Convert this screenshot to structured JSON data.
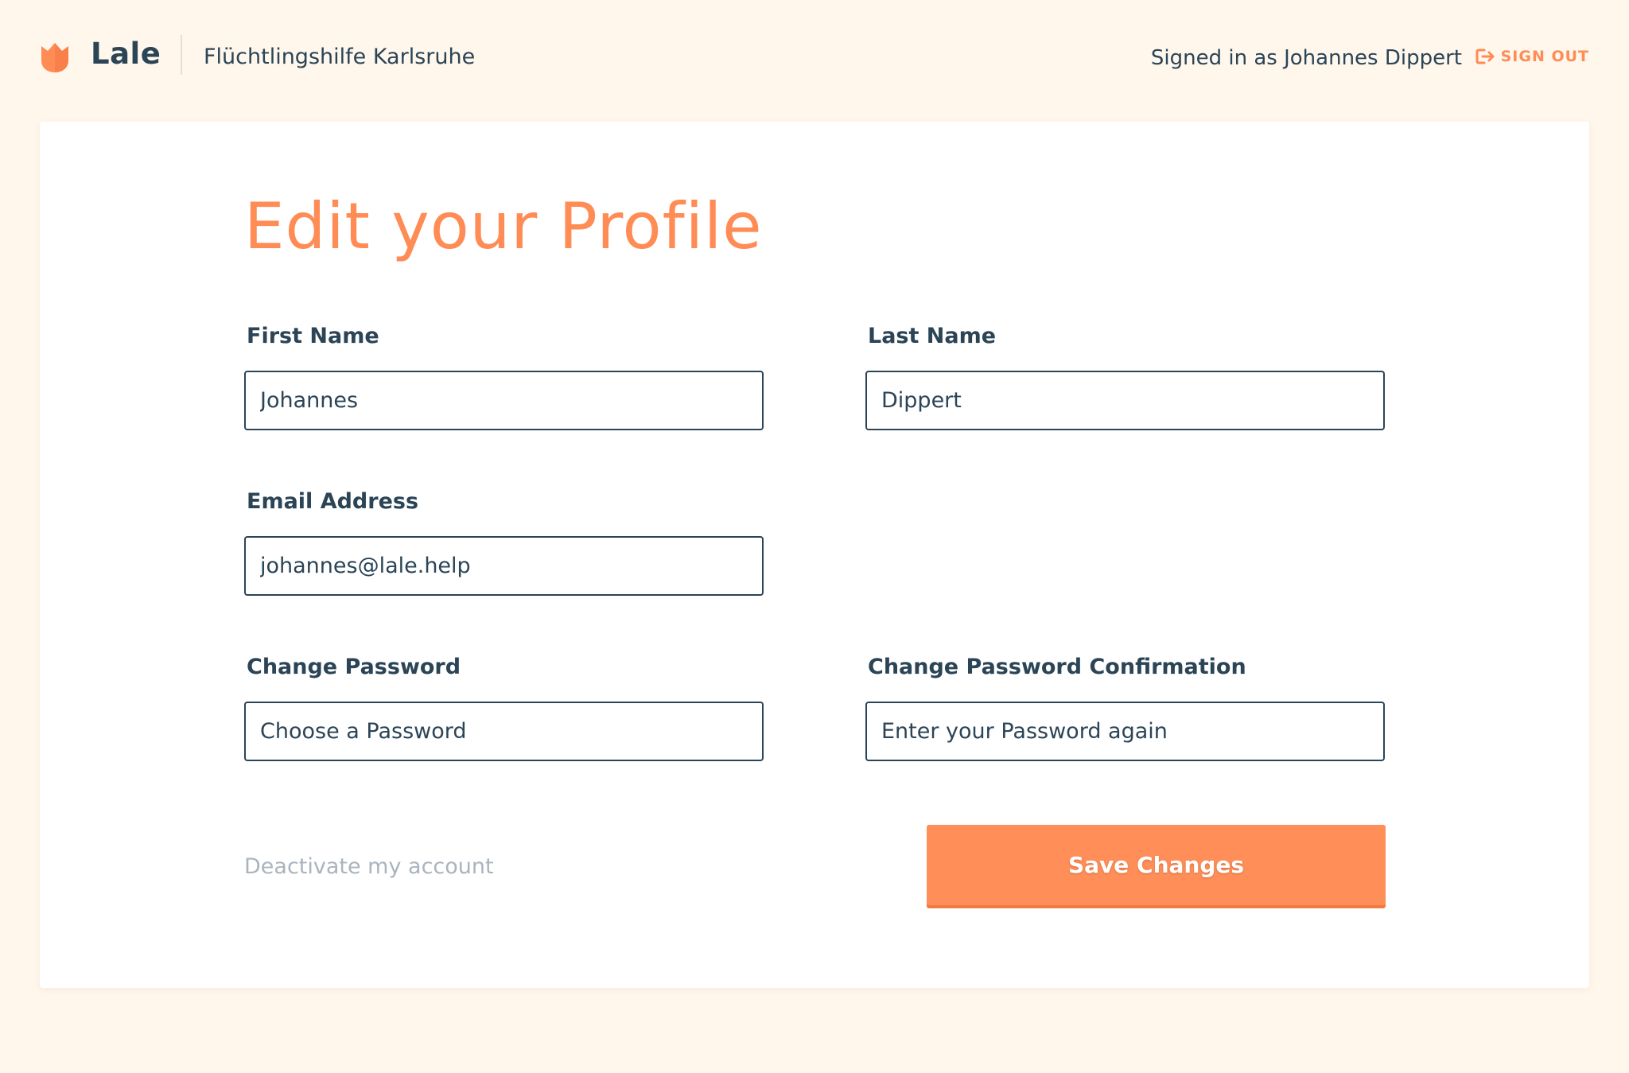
{
  "header": {
    "brand": "Lale",
    "org_name": "Flüchtlingshilfe Karlsruhe",
    "signed_in_text": "Signed in as Johannes Dippert",
    "sign_out_label": "SIGN OUT",
    "logo_icon": "tulip-icon",
    "sign_out_icon": "sign-out-icon"
  },
  "form": {
    "title": "Edit your Profile",
    "first_name": {
      "label": "First Name",
      "value": "Johannes"
    },
    "last_name": {
      "label": "Last Name",
      "value": "Dippert"
    },
    "email": {
      "label": "Email Address",
      "value": "johannes@lale.help"
    },
    "password": {
      "label": "Change Password",
      "placeholder": "Choose a Password"
    },
    "password_confirmation": {
      "label": "Change Password Confirmation",
      "placeholder": "Enter your Password again"
    },
    "deactivate_label": "Deactivate my account",
    "save_label": "Save Changes"
  },
  "colors": {
    "accent": "#ff8b55",
    "text": "#2b4456",
    "background": "#fff7ec",
    "muted": "#aab4bd"
  }
}
